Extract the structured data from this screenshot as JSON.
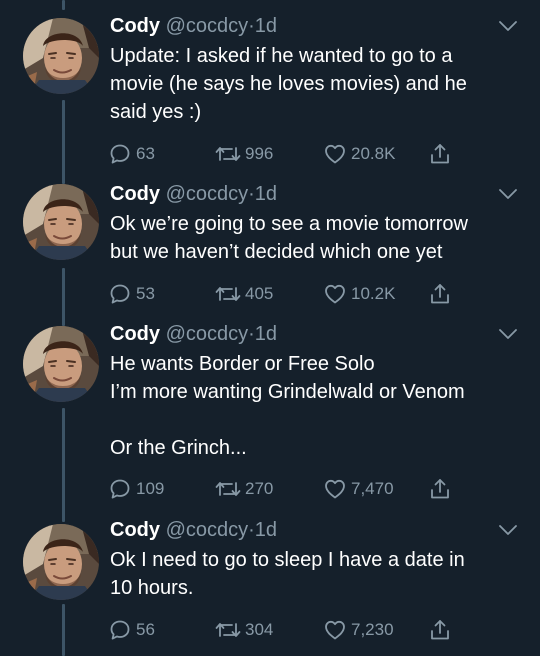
{
  "author": {
    "name": "Cody",
    "handle": "@cocdcy",
    "separator": "·",
    "time": "1d"
  },
  "icons": {
    "reply": "reply-bubble-icon",
    "retweet": "retweet-arrows-icon",
    "like": "heart-outline-icon",
    "share": "share-upload-icon",
    "menu": "chevron-down-icon"
  },
  "colors": {
    "background": "#15202b",
    "text": "#ffffff",
    "secondary": "#8899a6",
    "thread_line": "#3d5466"
  },
  "tweets": [
    {
      "lines": [
        "Update: I asked if he wanted to go to a",
        "movie (he says he loves movies) and he",
        "said yes :)"
      ],
      "replies": "63",
      "retweets": "996",
      "likes": "20.8K"
    },
    {
      "lines": [
        "Ok we’re going to see a movie tomorrow",
        "but we haven’t decided which one yet"
      ],
      "replies": "53",
      "retweets": "405",
      "likes": "10.2K"
    },
    {
      "lines": [
        "He wants Border or Free Solo",
        "I’m more wanting Grindelwald or Venom",
        "",
        "Or the Grinch..."
      ],
      "replies": "109",
      "retweets": "270",
      "likes": "7,470"
    },
    {
      "lines": [
        "Ok I need to go to sleep I have a date in",
        "10 hours."
      ],
      "replies": "56",
      "retweets": "304",
      "likes": "7,230"
    }
  ]
}
